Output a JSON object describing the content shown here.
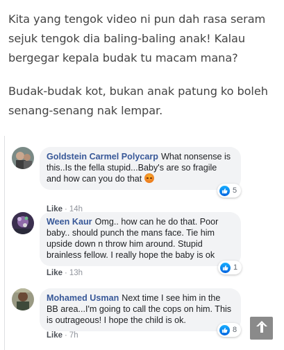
{
  "article": {
    "paragraphs": [
      "Kita yang tengok video ni pun dah rasa seram sejuk tengok dia baling-baling anak! Kalau bergegar kepala budak tu macam mana?",
      "Budak-budak kot, bukan anak patung ko boleh senang-senang nak lempar."
    ]
  },
  "comments": [
    {
      "author": "Goldstein Carmel Polycarp",
      "text": "What nonsense is this..Is the fella stupid...Baby's are so fragile and how can you do that",
      "emoji_icon": "angry-face-icon",
      "reaction_count": "5",
      "like_label": "Like",
      "time": "14h"
    },
    {
      "author": "Ween Kaur",
      "text": "Omg.. how can he do that. Poor baby.. should punch the mans face. Tie him upside down n throw him around. Stupid brainless fellow. I really hope the baby is ok",
      "reaction_count": "1",
      "like_label": "Like",
      "time": "13h"
    },
    {
      "author": "Mohamed Usman",
      "text": "Next time I see him in the BB area...I'm going to call the cops on him. This is outrageous! I hope the child is ok.",
      "reaction_count": "8",
      "like_label": "Like",
      "time": "7h"
    }
  ],
  "scroll_top": {
    "icon": "arrow-up-icon"
  },
  "colors": {
    "author": "#385898",
    "bubble": "#f2f3f5",
    "like_blue": "#1877f2",
    "article_text": "#444444"
  }
}
